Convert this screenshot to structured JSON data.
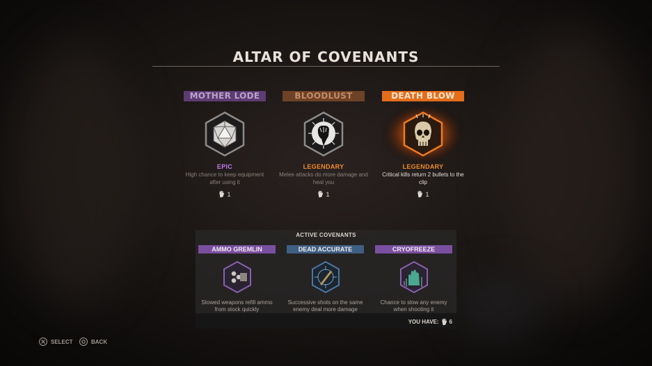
{
  "title": "ALTAR OF COVENANTS",
  "offers": [
    {
      "name": "MOTHER LODE",
      "banner_color": "#5d3b73",
      "name_color": "#b9a3c7",
      "rarity": "EPIC",
      "rarity_color": "#c07bf0",
      "description": "High chance to keep equipment after using it",
      "cost": "1",
      "icon": "d20-dice-icon"
    },
    {
      "name": "BLOODLUST",
      "banner_color": "#6e4226",
      "name_color": "#c28c6a",
      "rarity": "LEGENDARY",
      "rarity_color": "#f08a2c",
      "description": "Melee attacks do more damage and heal you",
      "cost": "1",
      "icon": "fist-icon"
    },
    {
      "name": "DEATH BLOW",
      "banner_color": "#e36d1a",
      "name_color": "#fbe5d3",
      "rarity": "LEGENDARY",
      "rarity_color": "#f08a2c",
      "description": "Critical kills return 2 bullets to the clip",
      "cost": "1",
      "icon": "skull-icon",
      "selected": true
    }
  ],
  "active_panel": {
    "header": "ACTIVE COVENANTS",
    "items": [
      {
        "name": "AMMO GREMLIN",
        "banner_color": "#7b4fa0",
        "description": "Stowed weapons refill ammo from stock quickly",
        "icon": "bullets-icon"
      },
      {
        "name": "DEAD ACCURATE",
        "banner_color": "#3f5f82",
        "description": "Successive shots on the same enemy deal more damage",
        "icon": "crosshair-bullet-icon"
      },
      {
        "name": "CRYOFREEZE",
        "banner_color": "#7b4fa0",
        "description": "Chance to slow any enemy when shooting it",
        "icon": "frozen-hand-icon"
      }
    ],
    "you_have_label": "YOU HAVE:",
    "you_have_count": "6"
  },
  "hints": [
    {
      "button": "cross-button-icon",
      "label": "SELECT"
    },
    {
      "button": "circle-button-icon",
      "label": "BACK"
    }
  ]
}
